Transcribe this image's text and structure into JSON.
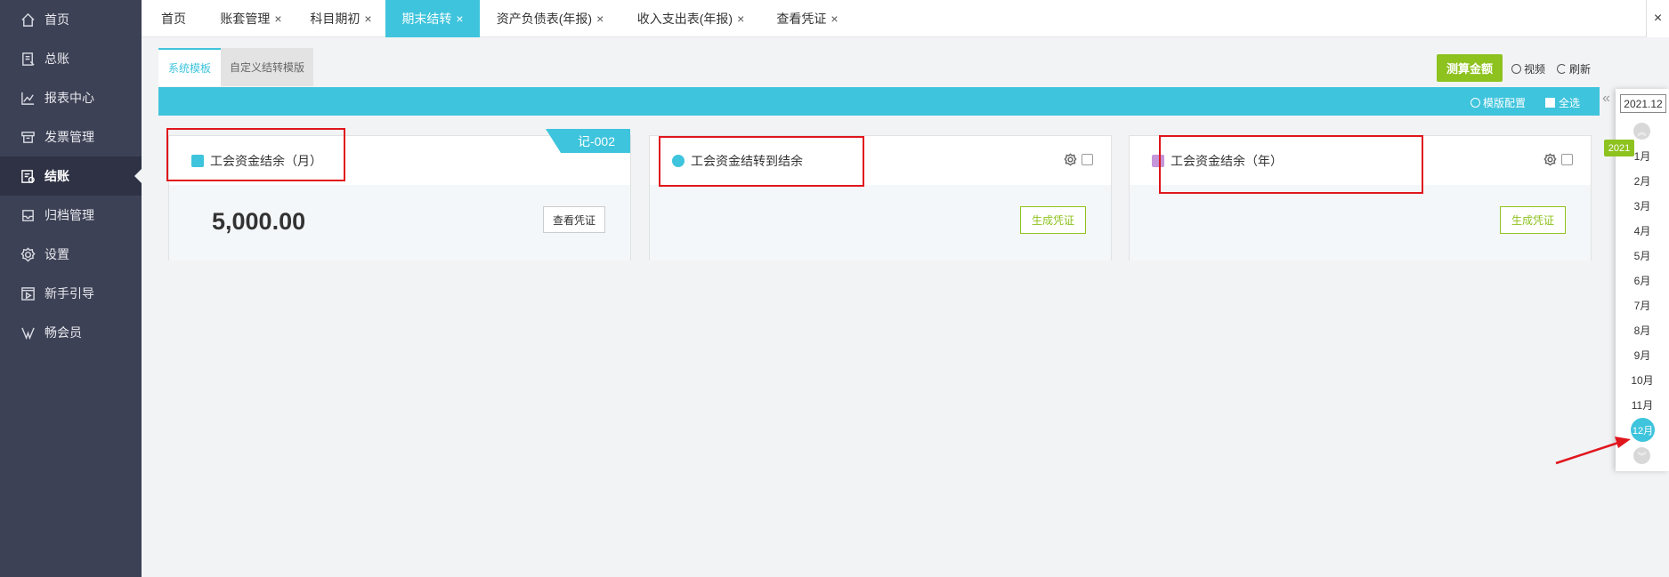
{
  "sidebar": {
    "items": [
      {
        "label": "首页",
        "icon": "home-icon"
      },
      {
        "label": "总账",
        "icon": "ledger-icon"
      },
      {
        "label": "报表中心",
        "icon": "chart-icon"
      },
      {
        "label": "发票管理",
        "icon": "invoice-icon"
      },
      {
        "label": "结账",
        "icon": "checkout-icon",
        "active": true
      },
      {
        "label": "归档管理",
        "icon": "archive-icon"
      },
      {
        "label": "设置",
        "icon": "gear-icon"
      },
      {
        "label": "新手引导",
        "icon": "video-icon"
      },
      {
        "label": "畅会员",
        "icon": "vip-icon"
      }
    ]
  },
  "tabs": [
    {
      "label": "首页"
    },
    {
      "label": "账套管理"
    },
    {
      "label": "科目期初"
    },
    {
      "label": "期末结转",
      "active": true
    },
    {
      "label": "资产负债表(年报)"
    },
    {
      "label": "收入支出表(年报)"
    },
    {
      "label": "查看凭证"
    }
  ],
  "close_glyph": "×",
  "subtabs": {
    "system": "系统模板",
    "custom": "自定义结转模版"
  },
  "toolbar": {
    "calc": "测算金额",
    "video": "视频",
    "refresh": "刷新"
  },
  "bluebar": {
    "template_config": "模版配置",
    "select_all": "全选"
  },
  "cards": [
    {
      "title": "工会资金结余（月）",
      "amount": "5,000.00",
      "tag": "记-002",
      "button": "查看凭证"
    },
    {
      "title": "工会资金结转到结余",
      "button": "生成凭证"
    },
    {
      "title": "工会资金结余（年）",
      "button": "生成凭证"
    }
  ],
  "period": {
    "year_month": "2021.12",
    "year": "2021",
    "months": [
      "1月",
      "2月",
      "3月",
      "4月",
      "5月",
      "6月",
      "7月",
      "8月",
      "9月",
      "10月",
      "11月",
      "12月"
    ],
    "selected": "12月"
  },
  "colors": {
    "accent": "#3ec4dc",
    "green": "#8dc21f",
    "sidebar": "#3d4155",
    "annotation": "#e0161d"
  }
}
